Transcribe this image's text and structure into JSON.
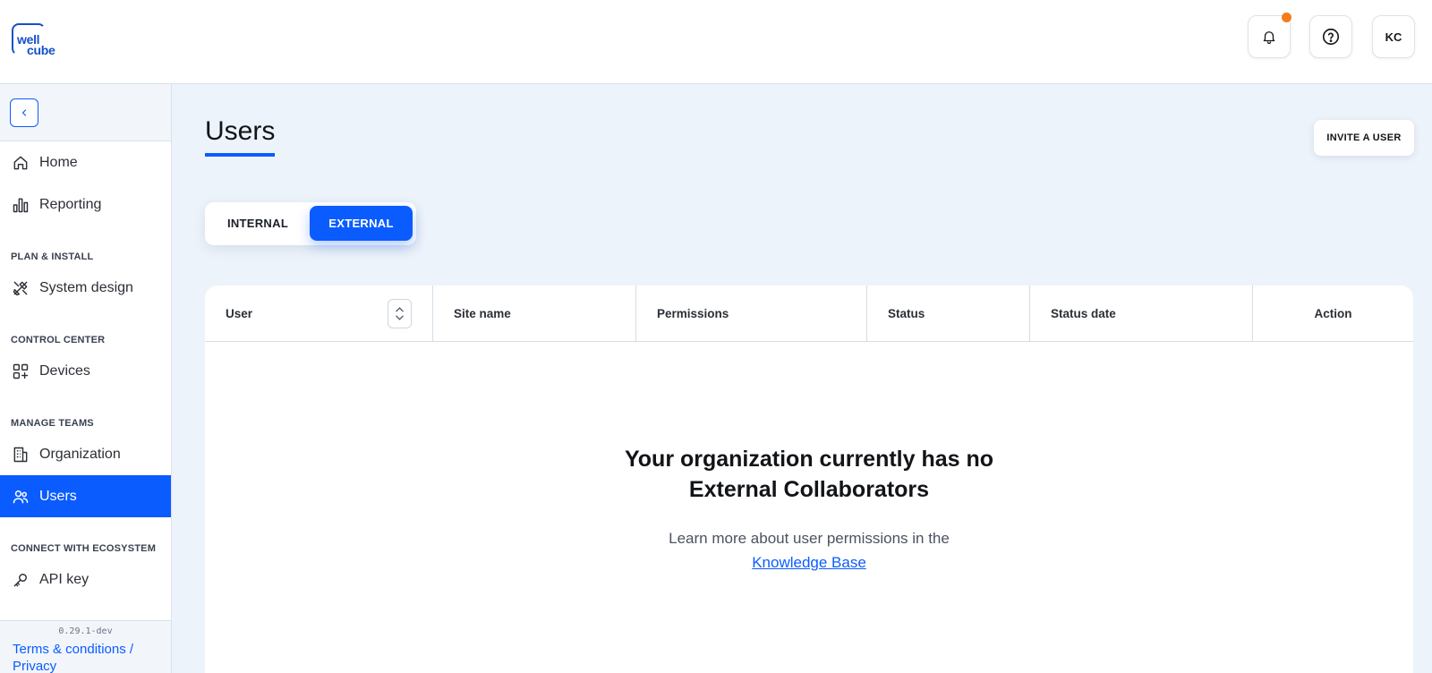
{
  "brand": {
    "logo_line1": "well",
    "logo_line2": "cube"
  },
  "header": {
    "avatar_initials": "KC",
    "notification_dot_color": "#f47c1a"
  },
  "sidebar": {
    "items": [
      {
        "label": "Home",
        "icon": "home-icon"
      },
      {
        "label": "Reporting",
        "icon": "bar-chart-icon"
      },
      {
        "label": "System design",
        "icon": "tools-icon"
      },
      {
        "label": "Devices",
        "icon": "devices-grid-icon"
      },
      {
        "label": "Organization",
        "icon": "building-icon"
      },
      {
        "label": "Users",
        "icon": "users-icon",
        "active": true
      },
      {
        "label": "API key",
        "icon": "key-icon"
      }
    ],
    "sections": {
      "plan": "PLAN & INSTALL",
      "control": "CONTROL CENTER",
      "teams": "MANAGE TEAMS",
      "ecosystem": "CONNECT WITH ECOSYSTEM"
    },
    "version": "0.29.1-dev",
    "terms": "Terms & conditions / Privacy"
  },
  "main": {
    "title": "Users",
    "invite_label": "INVITE A USER",
    "tabs": [
      {
        "label": "INTERNAL",
        "active": false
      },
      {
        "label": "EXTERNAL",
        "active": true
      }
    ],
    "table": {
      "columns": [
        "User",
        "Site name",
        "Permissions",
        "Status",
        "Status date",
        "Action"
      ]
    },
    "empty_state": {
      "title_line1": "Your organization currently has no",
      "title_line2": "External Collaborators",
      "sub": "Learn more about user permissions in the",
      "link": "Knowledge Base"
    }
  },
  "colors": {
    "accent": "#0a5cff",
    "page_bg": "#edf3fa"
  }
}
